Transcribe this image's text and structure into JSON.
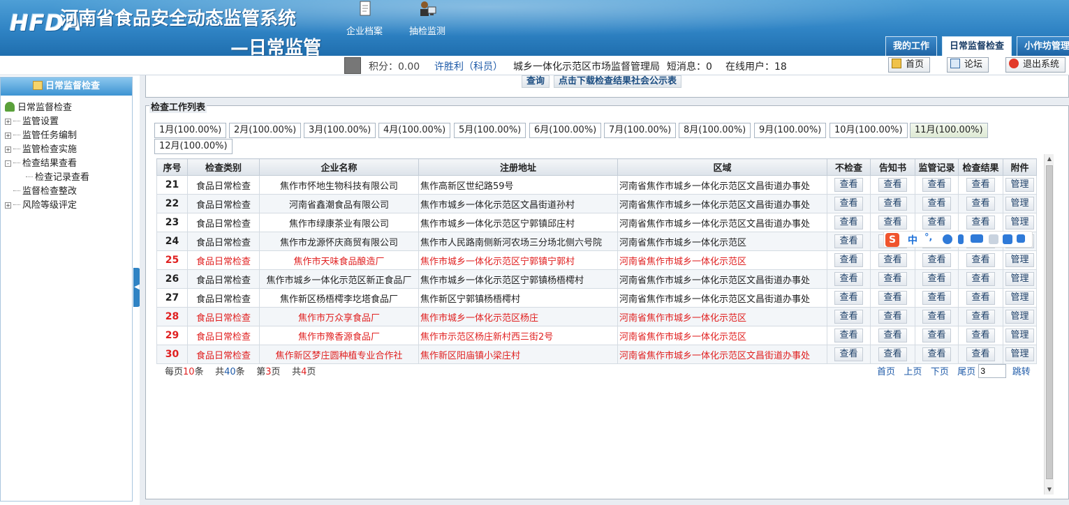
{
  "header": {
    "logo": "HFDA",
    "title": "河南省食品安全动态监管系统",
    "subtitle": "—日常监管",
    "nav": [
      {
        "label": "企业档案",
        "icon": "document-icon"
      },
      {
        "label": "抽检监测",
        "icon": "inspector-icon"
      }
    ],
    "tabs": [
      {
        "label": "我的工作",
        "active": false
      },
      {
        "label": "日常监督检查",
        "active": true
      },
      {
        "label": "小作坊管理",
        "active": false
      }
    ]
  },
  "infobar": {
    "points": "积分：0.00",
    "user": "许胜利（科员）",
    "org": "城乡一体化示范区市场监督管理局",
    "messages": "短消息：0",
    "online": "在线用户：18",
    "home": "首页",
    "forum": "论坛",
    "logout": "退出系统"
  },
  "sidebar": {
    "title": "日常监督检查",
    "root": "日常监督检查",
    "items": [
      {
        "label": "监管设置",
        "expander": "+"
      },
      {
        "label": "监管任务编制",
        "expander": "+"
      },
      {
        "label": "监管检查实施",
        "expander": "+"
      },
      {
        "label": "检查结果查看",
        "expander": "-"
      },
      {
        "label": "检查记录查看",
        "expander": ""
      },
      {
        "label": "监督检查整改",
        "expander": ""
      },
      {
        "label": "风险等级评定",
        "expander": "+"
      }
    ]
  },
  "toolbar": {
    "query": "查询",
    "download": "点击下载检查结果社会公示表"
  },
  "list": {
    "legend": "检查工作列表",
    "months": [
      "1月(100.00%)",
      "2月(100.00%)",
      "3月(100.00%)",
      "4月(100.00%)",
      "5月(100.00%)",
      "6月(100.00%)",
      "7月(100.00%)",
      "8月(100.00%)",
      "9月(100.00%)",
      "10月(100.00%)",
      "11月(100.00%)",
      "12月(100.00%)"
    ],
    "active_month": 10,
    "columns": [
      "序号",
      "检查类别",
      "企业名称",
      "注册地址",
      "区域",
      "不检查",
      "告知书",
      "监管记录",
      "检查结果",
      "附件"
    ],
    "action_labels": [
      "查看",
      "查看",
      "查看",
      "查看",
      "管理"
    ],
    "rows": [
      {
        "no": "21",
        "type": "食品日常检查",
        "name": "焦作市怀地生物科技有限公司",
        "addr": "焦作高新区世纪路59号",
        "area": "河南省焦作市城乡一体化示范区文昌街道办事处",
        "red": false
      },
      {
        "no": "22",
        "type": "食品日常检查",
        "name": "河南省鑫潮食品有限公司",
        "addr": "焦作市城乡一体化示范区文昌街道孙村",
        "area": "河南省焦作市城乡一体化示范区文昌街道办事处",
        "red": false
      },
      {
        "no": "23",
        "type": "食品日常检查",
        "name": "焦作市绿康茶业有限公司",
        "addr": "焦作市城乡一体化示范区宁郭镇邱庄村",
        "area": "河南省焦作市城乡一体化示范区文昌街道办事处",
        "red": false
      },
      {
        "no": "24",
        "type": "食品日常检查",
        "name": "焦作市龙源怀庆商贸有限公司",
        "addr": "焦作市人民路南侧新河农场三分场北侧六号院",
        "area": "河南省焦作市城乡一体化示范区",
        "red": false
      },
      {
        "no": "25",
        "type": "食品日常检查",
        "name": "焦作市天味食品酿造厂",
        "addr": "焦作市城乡一体化示范区宁郭镇宁郭村",
        "area": "河南省焦作市城乡一体化示范区",
        "red": true
      },
      {
        "no": "26",
        "type": "食品日常检查",
        "name": "焦作市城乡一体化示范区新正食品厂",
        "addr": "焦作市城乡一体化示范区宁郭镇杨梧樗村",
        "area": "河南省焦作市城乡一体化示范区文昌街道办事处",
        "red": false
      },
      {
        "no": "27",
        "type": "食品日常检查",
        "name": "焦作新区杨梧樗李圪塔食品厂",
        "addr": "焦作新区宁郭镇杨梧樗村",
        "area": "河南省焦作市城乡一体化示范区文昌街道办事处",
        "red": false
      },
      {
        "no": "28",
        "type": "食品日常检查",
        "name": "焦作市万众享食品厂",
        "addr": "焦作市城乡一体化示范区杨庄",
        "area": "河南省焦作市城乡一体化示范区",
        "red": true
      },
      {
        "no": "29",
        "type": "食品日常检查",
        "name": "焦作市豫香源食品厂",
        "addr": "焦作市示范区杨庄新村西三街2号",
        "area": "河南省焦作市城乡一体化示范区",
        "red": true
      },
      {
        "no": "30",
        "type": "食品日常检查",
        "name": "焦作新区梦庄圆种植专业合作社",
        "addr": "焦作新区阳庙镇小梁庄村",
        "area": "河南省焦作市城乡一体化示范区文昌街道办事处",
        "red": true
      }
    ]
  },
  "pager": {
    "per_page_prefix": "每页",
    "per_page": "10",
    "per_page_suffix": "条",
    "total_prefix": "共",
    "total": "40",
    "total_suffix": "条",
    "page_prefix": "第",
    "page": "3",
    "page_suffix": "页",
    "pages_prefix": "共",
    "pages": "4",
    "pages_suffix": "页",
    "first": "首页",
    "prev": "上页",
    "next": "下页",
    "last": "尾页",
    "goto_value": "3",
    "goto": "跳转"
  },
  "ime": {
    "logo": "S",
    "lang": "中"
  },
  "colors": {
    "header_blue": "#2f83c4",
    "alert_red": "#e02020",
    "link_blue": "#1e5aa8"
  }
}
